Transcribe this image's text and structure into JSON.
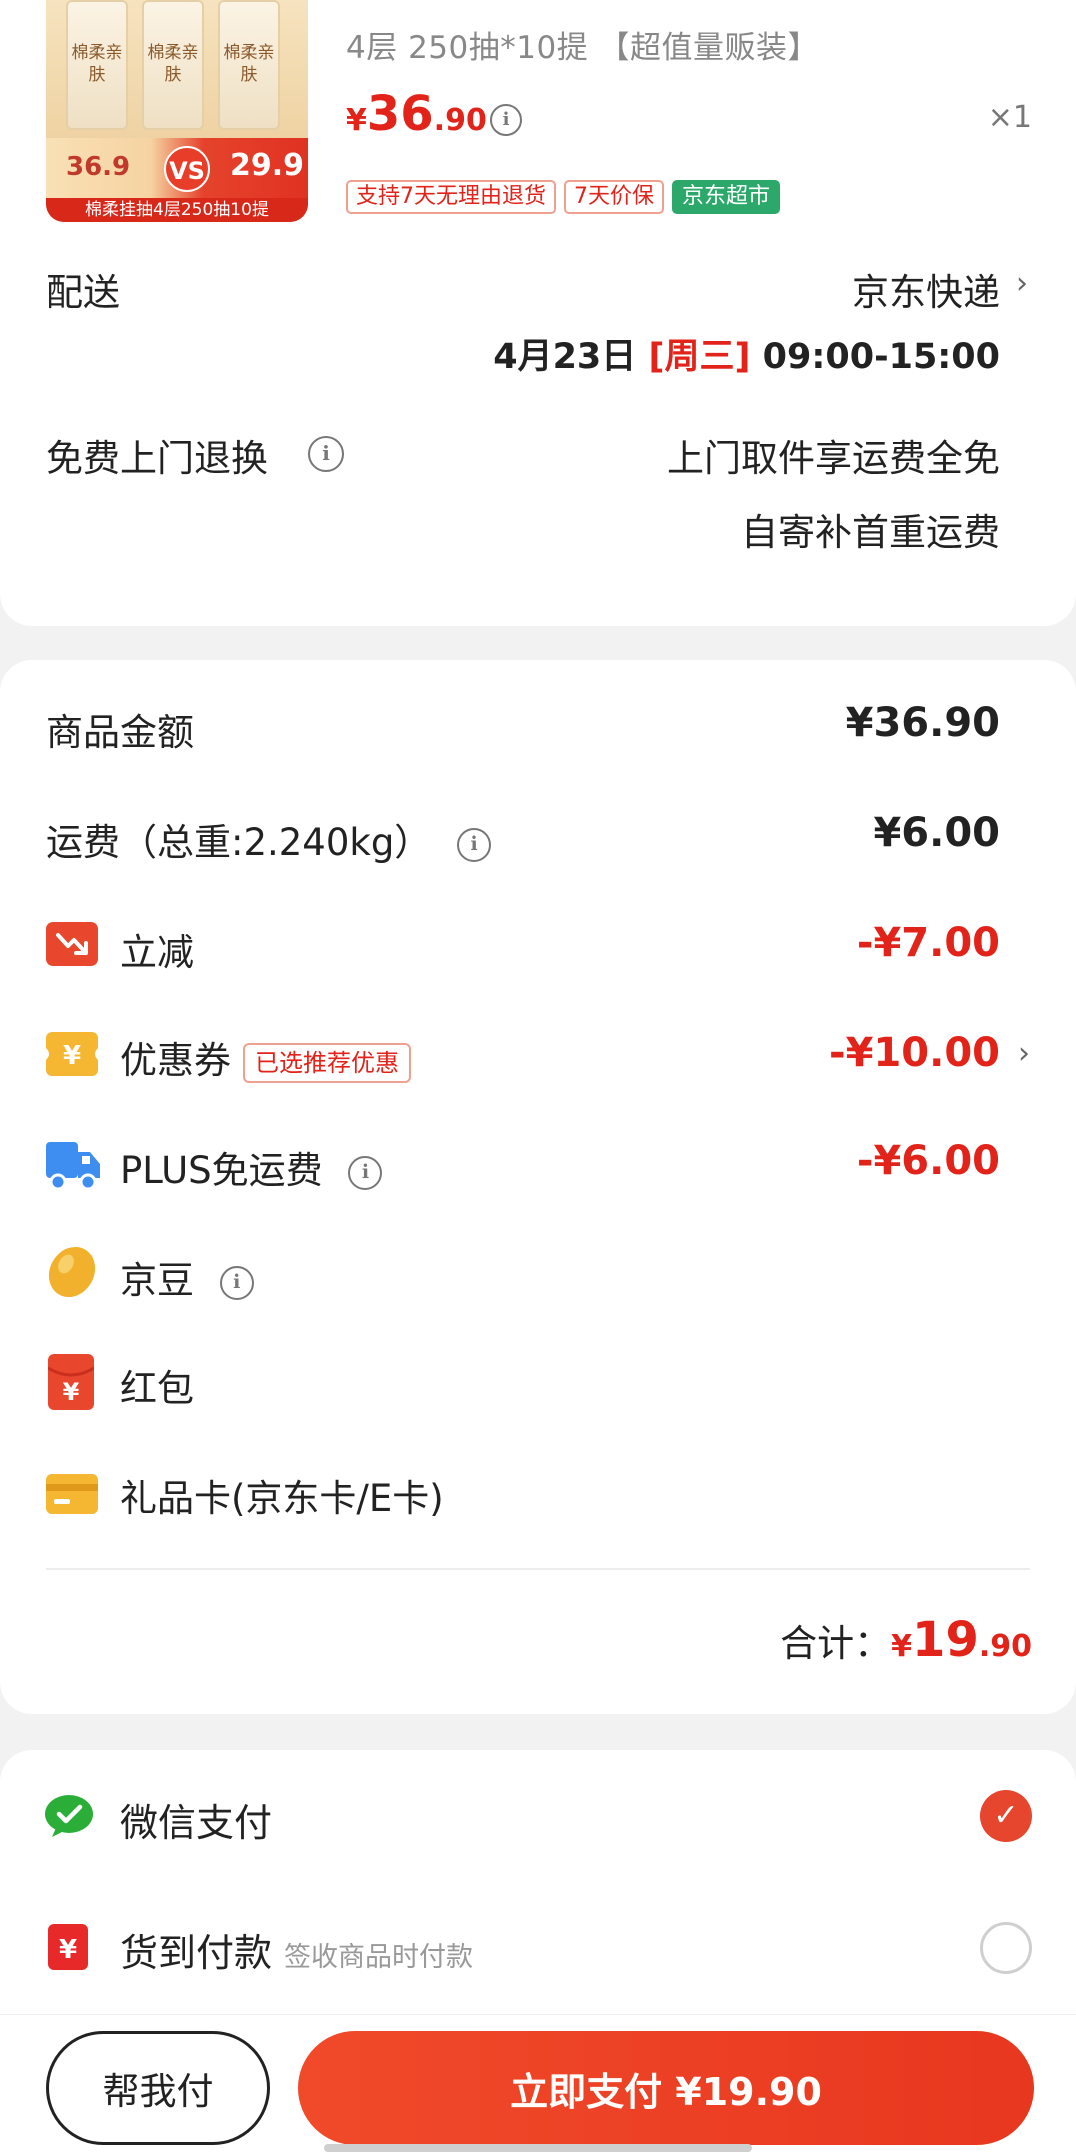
{
  "product": {
    "thumb": {
      "pkg_label": "棉柔亲肤",
      "old_price": "36.9",
      "vs": "VS",
      "new_price": "29.9",
      "caption": "棉柔挂抽4层250抽10提"
    },
    "spec": "4层 250抽*10提 【超值量贩装】",
    "price_currency": "¥",
    "price_int": "36",
    "price_dec": ".90",
    "quantity": "×1",
    "tags": [
      "支持7天无理由退货",
      "7天价保",
      "京东超市"
    ]
  },
  "delivery": {
    "label": "配送",
    "carrier": "京东快递",
    "date": "4月23日",
    "weekday": "[周三]",
    "time": "09:00-15:00"
  },
  "returns": {
    "label": "免费上门退换",
    "line1": "上门取件享运费全免",
    "line2": "自寄补首重运费"
  },
  "summary": {
    "goods_label": "商品金额",
    "goods_value": "¥36.90",
    "shipping_label": "运费（总重:2.240kg）",
    "shipping_value": "¥6.00",
    "discount_label": "立减",
    "discount_value": "-¥7.00",
    "coupon_label": "优惠券",
    "coupon_badge": "已选推荐优惠",
    "coupon_value": "-¥10.00",
    "plus_label": "PLUS免运费",
    "plus_value": "-¥6.00",
    "beans_label": "京豆",
    "redpacket_label": "红包",
    "giftcard_label": "礼品卡(京东卡/E卡)",
    "total_label": "合计：",
    "total_currency": "¥",
    "total_int": "19",
    "total_dec": ".90"
  },
  "payment": {
    "wechat_label": "微信支付",
    "cod_label": "货到付款",
    "cod_sub": "签收商品时付款",
    "selected": "wechat"
  },
  "actions": {
    "help_label": "帮我付",
    "pay_label": "立即支付 ¥19.90"
  },
  "colors": {
    "accent": "#e2231a",
    "pay_button": "#ea3d22",
    "tag_green": "#2ba86a",
    "wechat_green": "#2aae38"
  },
  "icons": {
    "info": "info-circle-icon",
    "chevron": "chevron-right-icon",
    "discount": "trend-down-icon",
    "coupon": "coupon-yen-icon",
    "plus": "delivery-truck-icon",
    "beans": "jd-bean-icon",
    "redpacket": "red-packet-icon",
    "giftcard": "gift-card-icon",
    "wechat": "wechat-pay-icon",
    "cod": "cash-on-delivery-icon",
    "check": "check-icon"
  }
}
